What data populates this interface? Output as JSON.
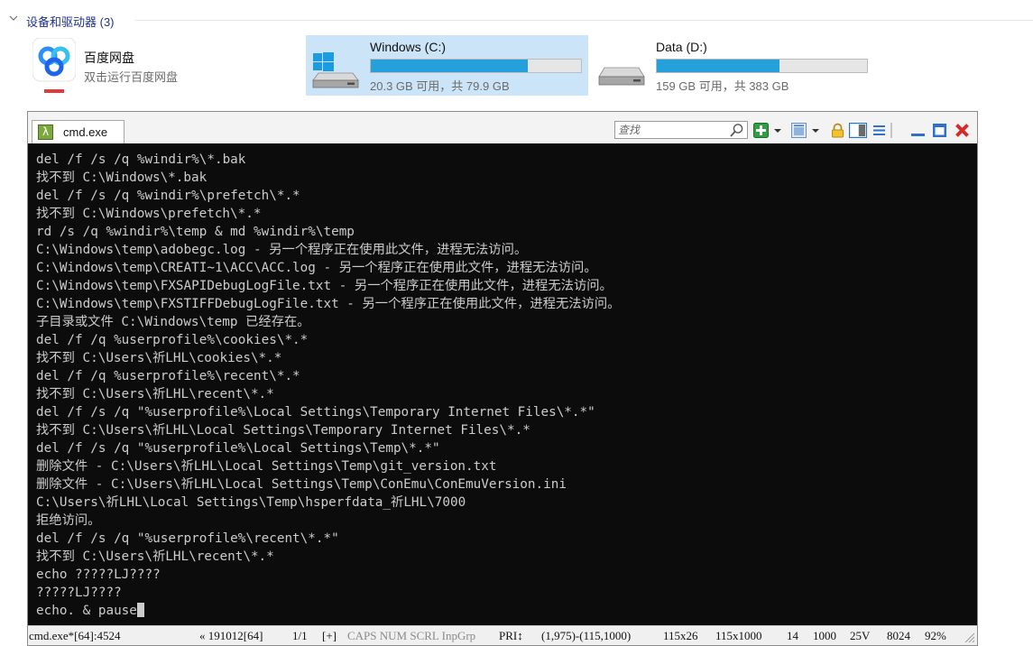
{
  "explorer": {
    "group_title": "设备和驱动器 (3)",
    "app": {
      "name": "百度网盘",
      "subtitle": "双击运行百度网盘",
      "icon": "baidu-netdisk-logo"
    },
    "drives": [
      {
        "name": "Windows (C:)",
        "capacity": "20.3 GB 可用，共 79.9 GB",
        "used_fraction": 0.746,
        "selected": true,
        "icon": "os-drive-icon"
      },
      {
        "name": "Data (D:)",
        "capacity": "159 GB 可用，共 383 GB",
        "used_fraction": 0.585,
        "selected": false,
        "icon": "hard-drive-icon"
      }
    ]
  },
  "conemu": {
    "tab_label": "cmd.exe",
    "search_placeholder": "查找",
    "console_lines": [
      "del /f /s /q %windir%\\*.bak",
      "找不到 C:\\Windows\\*.bak",
      "del /f /s /q %windir%\\prefetch\\*.*",
      "找不到 C:\\Windows\\prefetch\\*.*",
      "rd /s /q %windir%\\temp & md %windir%\\temp",
      "C:\\Windows\\temp\\adobegc.log - 另一个程序正在使用此文件，进程无法访问。",
      "C:\\Windows\\temp\\CREATI~1\\ACC\\ACC.log - 另一个程序正在使用此文件，进程无法访问。",
      "C:\\Windows\\temp\\FXSAPIDebugLogFile.txt - 另一个程序正在使用此文件，进程无法访问。",
      "C:\\Windows\\temp\\FXSTIFFDebugLogFile.txt - 另一个程序正在使用此文件，进程无法访问。",
      "子目录或文件 C:\\Windows\\temp 已经存在。",
      "del /f /q %userprofile%\\cookies\\*.*",
      "找不到 C:\\Users\\祈LHL\\cookies\\*.*",
      "del /f /q %userprofile%\\recent\\*.*",
      "找不到 C:\\Users\\祈LHL\\recent\\*.*",
      "del /f /s /q \"%userprofile%\\Local Settings\\Temporary Internet Files\\*.*\"",
      "找不到 C:\\Users\\祈LHL\\Local Settings\\Temporary Internet Files\\*.*",
      "del /f /s /q \"%userprofile%\\Local Settings\\Temp\\*.*\"",
      "删除文件 - C:\\Users\\祈LHL\\Local Settings\\Temp\\git_version.txt",
      "删除文件 - C:\\Users\\祈LHL\\Local Settings\\Temp\\ConEmu\\ConEmuVersion.ini",
      "C:\\Users\\祈LHL\\Local Settings\\Temp\\hsperfdata_祈LHL\\7000",
      "拒绝访问。",
      "del /f /s /q \"%userprofile%\\recent\\*.*\"",
      "找不到 C:\\Users\\祈LHL\\recent\\*.*",
      "echo ?????LJ????",
      "?????LJ????"
    ],
    "prompt_line": "echo. & pause",
    "status": {
      "process": "cmd.exe*[64]:4524",
      "build": "« 191012[64]",
      "console_index": "1/1",
      "flags_plus": "[+]",
      "flags": "CAPS NUM SCRL InpGrp",
      "pri": "PRI↕",
      "coords": "(1,975)-(115,1000)",
      "size1": "115x26",
      "size2": "115x1000",
      "n1": "14",
      "n2": "1000",
      "n3": "25V",
      "n4": "8024",
      "zoom": "92%"
    }
  },
  "colors": {
    "link_blue": "#1e3287",
    "drive_bar_fill": "#26a0da",
    "selection": "#cce4f7",
    "console_bg": "#0c0c0c",
    "console_fg": "#cccccc"
  }
}
